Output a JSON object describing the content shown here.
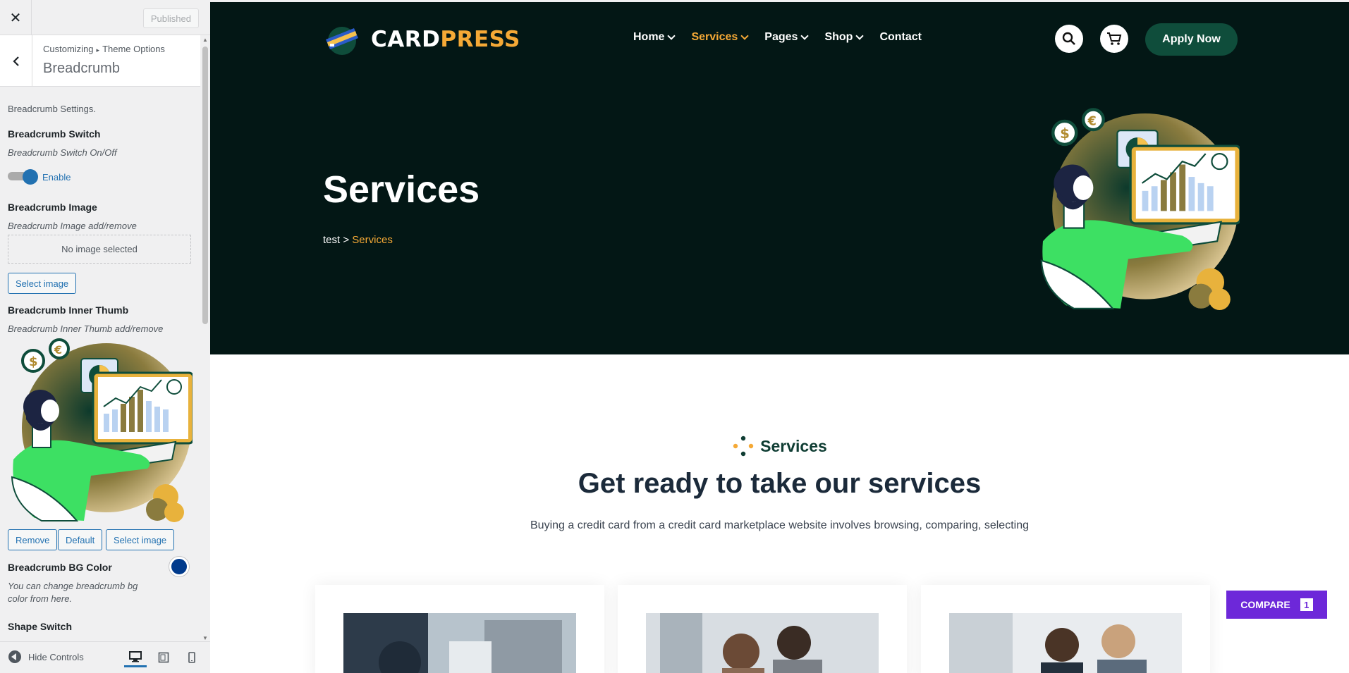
{
  "customizer": {
    "published_label": "Published",
    "breadcrumb_parent": "Customizing",
    "breadcrumb_section": "Theme Options",
    "section_title": "Breadcrumb",
    "settings_desc": "Breadcrumb Settings.",
    "switch_label": "Breadcrumb Switch",
    "switch_sub": "Breadcrumb Switch On/Off",
    "switch_state": "Enable",
    "image_label": "Breadcrumb Image",
    "image_sub": "Breadcrumb Image add/remove",
    "no_image": "No image selected",
    "select_image": "Select image",
    "thumb_label": "Breadcrumb Inner Thumb",
    "thumb_sub": "Breadcrumb Inner Thumb add/remove",
    "remove": "Remove",
    "default": "Default",
    "select_image_2": "Select image",
    "bg_color_label": "Breadcrumb BG Color",
    "bg_color_sub_1": "You can change breadcrumb bg",
    "bg_color_sub_2": "color from here.",
    "bg_color_value": "#003a8c",
    "shape_switch_label": "Shape Switch",
    "hide_controls": "Hide Controls",
    "devices": [
      "desktop-icon",
      "tablet-icon",
      "mobile-icon"
    ]
  },
  "site": {
    "logo_part1": "CARD",
    "logo_part2": "PRESS",
    "nav": [
      {
        "label": "Home",
        "dropdown": true,
        "active": false
      },
      {
        "label": "Services",
        "dropdown": true,
        "active": true
      },
      {
        "label": "Pages",
        "dropdown": true,
        "active": false
      },
      {
        "label": "Shop",
        "dropdown": true,
        "active": false
      },
      {
        "label": "Contact",
        "dropdown": false,
        "active": false
      }
    ],
    "apply_label": "Apply Now",
    "hero_title": "Services",
    "crumb_home": "test",
    "crumb_sep": ">",
    "crumb_current": "Services",
    "section_tag": "Services",
    "section_title": "Get ready to take our services",
    "section_desc": "Buying a credit card from a credit card marketplace website involves browsing, comparing, selecting",
    "compare_label": "COMPARE",
    "compare_count": "1",
    "colors": {
      "hero_bg": "#031715",
      "accent": "#f5a936",
      "apply_bg": "#0f4d3b",
      "compare_bg": "#6d28d9"
    }
  }
}
